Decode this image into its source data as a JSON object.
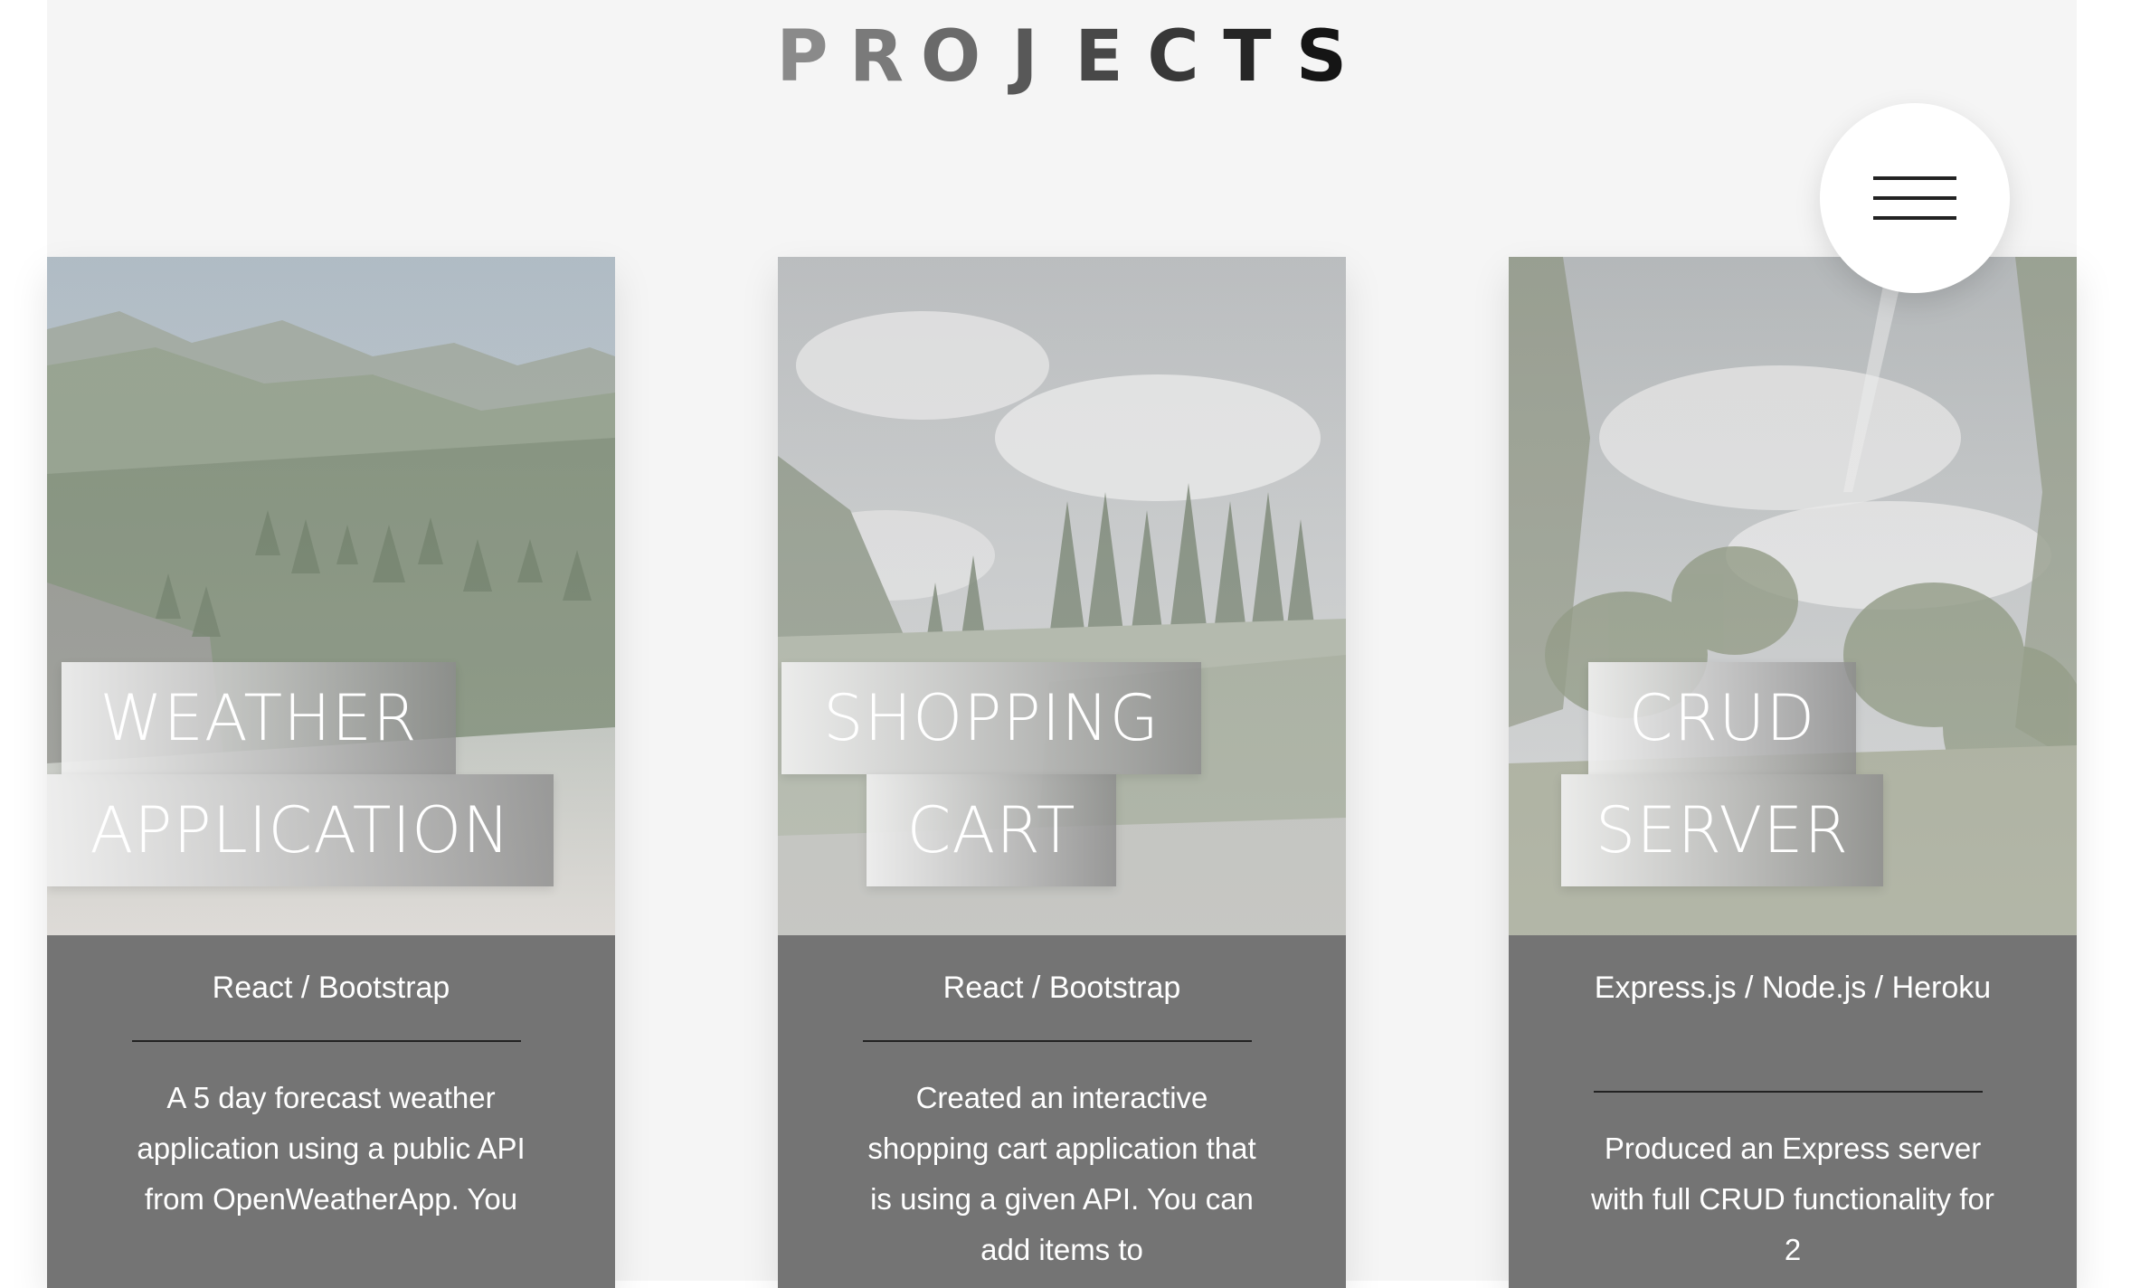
{
  "header": {
    "title_letters": [
      "P",
      "R",
      "O",
      "J",
      "E",
      "C",
      "T",
      "S"
    ],
    "title_colors": [
      "#8a8a8a",
      "#7a7a7a",
      "#6a6a6a",
      "#585858",
      "#484848",
      "#383838",
      "#262626",
      "#151515"
    ]
  },
  "menu": {
    "icon": "hamburger-icon"
  },
  "projects": [
    {
      "title_line1": "WEATHER",
      "title_line2": "APPLICATION",
      "tech": "React / Bootstrap",
      "description": "A 5 day forecast weather application using a public API from OpenWeatherApp. You"
    },
    {
      "title_line1": "SHOPPING",
      "title_line2": "CART",
      "tech": "React / Bootstrap",
      "description": "Created an interactive shopping cart application that is using a given API. You can add items to"
    },
    {
      "title_line1": "CRUD",
      "title_line2": "SERVER",
      "tech": "Express.js / Node.js / Heroku",
      "description": "Produced an Express server with full CRUD functionality for 2"
    }
  ]
}
